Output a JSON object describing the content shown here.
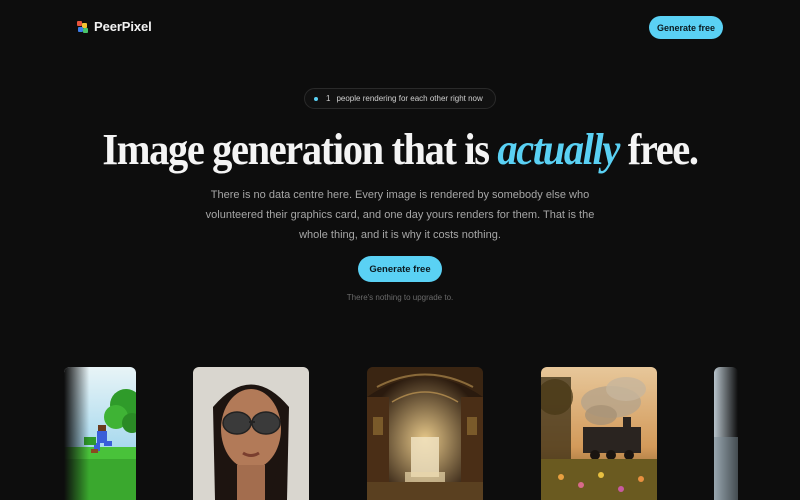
{
  "header": {
    "brand": "PeerPixel",
    "cta_label": "Generate free"
  },
  "hero": {
    "badge_count": "1",
    "badge_text": "people rendering for each other right now",
    "headline_before": "Image generation that is ",
    "headline_accent": "actually",
    "headline_after": " free.",
    "subtext": "There is no data centre here. Every image is rendered by somebody else who volunteered their graphics card, and one day yours renders for them. That is the whole thing, and it is why it costs nothing.",
    "cta_label": "Generate free",
    "hint": "There's nothing to upgrade to."
  },
  "gallery": {
    "items": [
      {
        "icon": "pixel-art-character-image"
      },
      {
        "icon": "woman-sunglasses-portrait-image"
      },
      {
        "icon": "ornate-hall-waterfall-image"
      },
      {
        "icon": "steam-train-sunset-image"
      },
      {
        "icon": "misty-landscape-image"
      }
    ]
  },
  "colors": {
    "background": "#0d0d0d",
    "accent": "#5ad1f4",
    "text_muted": "#a6a6a6"
  }
}
